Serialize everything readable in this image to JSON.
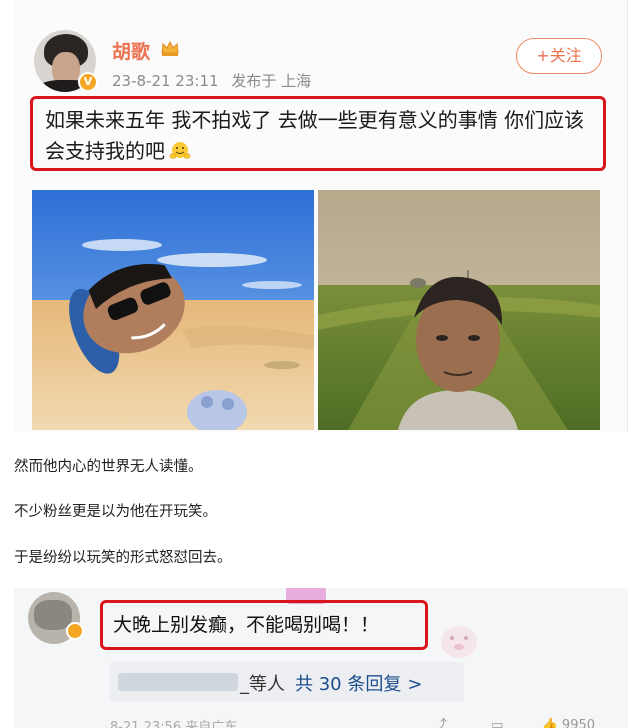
{
  "post": {
    "username": "胡歌",
    "date": "23-8-21 23:11",
    "location": "发布于 上海",
    "follow_label": "+关注",
    "text": "如果未来五年 我不拍戏了 去做一些更有意义的事情 你们应该会支持我的吧",
    "verified_badge": "V"
  },
  "article": {
    "line1": "然而他内心的世界无人读懂。",
    "line2": "不少粉丝更是以为他在开玩笑。",
    "line3": "于是纷纷以玩笑的形式怒怼回去。"
  },
  "comment": {
    "text": "大晚上别发癫，不能喝别喝！！",
    "reply_suffix": "_等人",
    "reply_count": "共 30 条回复",
    "reply_chevron": ">",
    "footer_date": "8-21 23:56 来自广东",
    "like_count": "9950"
  },
  "colors": {
    "accent": "#eb7350",
    "highlight_border": "#d9161c",
    "link": "#1a4e8c"
  }
}
